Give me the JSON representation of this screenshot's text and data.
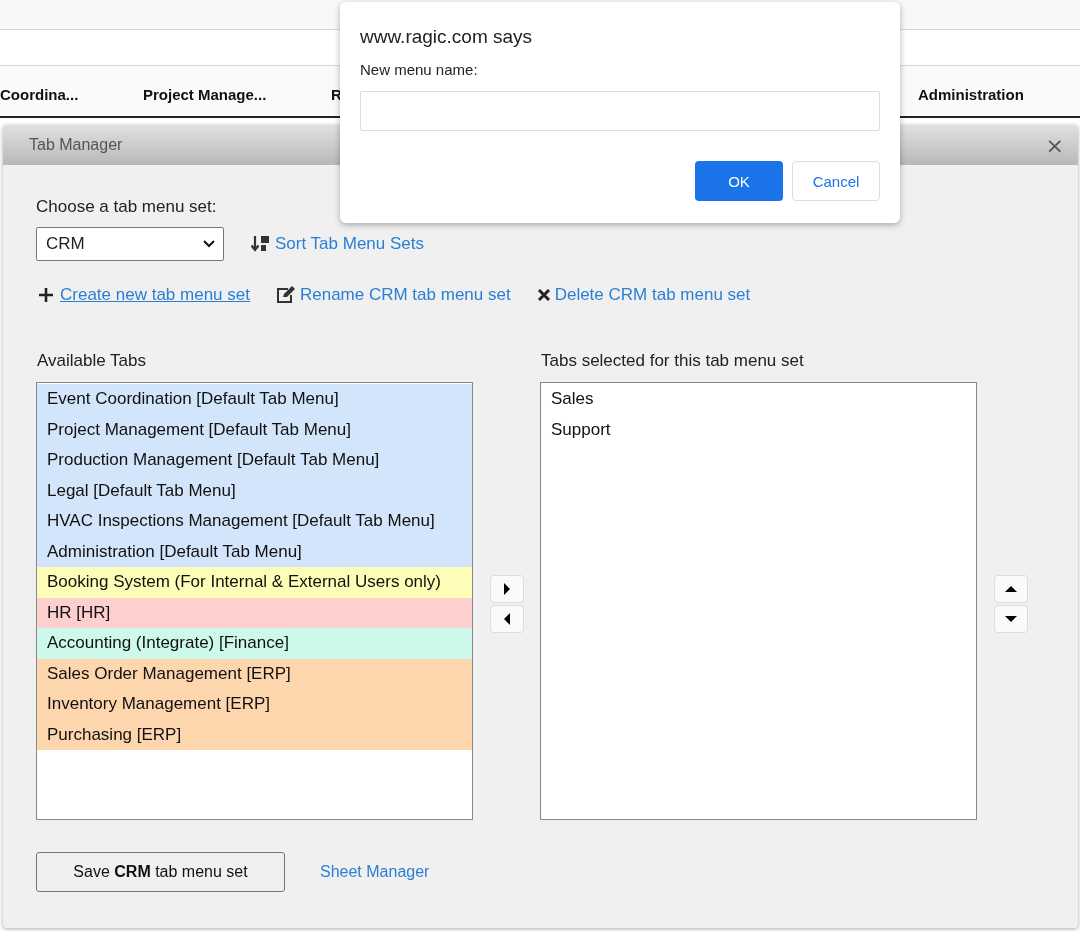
{
  "nav": {
    "tabs": [
      {
        "label": "Coordina..."
      },
      {
        "label": "Project Manage..."
      },
      {
        "label": "R"
      },
      {
        "label": "Administration"
      }
    ]
  },
  "tab_manager": {
    "title": "Tab Manager",
    "close": "×",
    "choose_label": "Choose a tab menu set:",
    "menu_set": "CRM",
    "sort_link": "Sort Tab Menu Sets",
    "create_link": "Create new tab menu set",
    "rename_link": "Rename CRM tab menu set",
    "delete_link": "Delete CRM tab menu set",
    "available_title": "Available Tabs",
    "available": [
      {
        "label": "Event Coordination [Default Tab Menu]",
        "color": "#d3e5fb"
      },
      {
        "label": "Project Management [Default Tab Menu]",
        "color": "#d3e5fb"
      },
      {
        "label": "Production Management [Default Tab Menu]",
        "color": "#d3e5fb"
      },
      {
        "label": "Legal [Default Tab Menu]",
        "color": "#d3e5fb"
      },
      {
        "label": "HVAC Inspections Management [Default Tab Menu]",
        "color": "#d3e5fb"
      },
      {
        "label": "Administration [Default Tab Menu]",
        "color": "#d3e5fb"
      },
      {
        "label": "Booking System (For Internal & External Users only)",
        "color": "#fdfdb7"
      },
      {
        "label": "HR [HR]",
        "color": "#fdcfcf"
      },
      {
        "label": "Accounting (Integrate) [Finance]",
        "color": "#cdf8ec"
      },
      {
        "label": "Sales Order Management [ERP]",
        "color": "#fed6ae"
      },
      {
        "label": "Inventory Management [ERP]",
        "color": "#fed6ae"
      },
      {
        "label": "Purchasing [ERP]",
        "color": "#fed6ae"
      }
    ],
    "selected_title": "Tabs selected for this tab menu set",
    "selected": [
      {
        "label": "Sales"
      },
      {
        "label": "Support"
      }
    ],
    "save_button": "Save **CRM** tab menu set",
    "sheet_manager_link": "Sheet Manager"
  },
  "prompt": {
    "title": "www.ragic.com says",
    "label": "New menu name:",
    "ok": "OK",
    "cancel": "Cancel"
  }
}
